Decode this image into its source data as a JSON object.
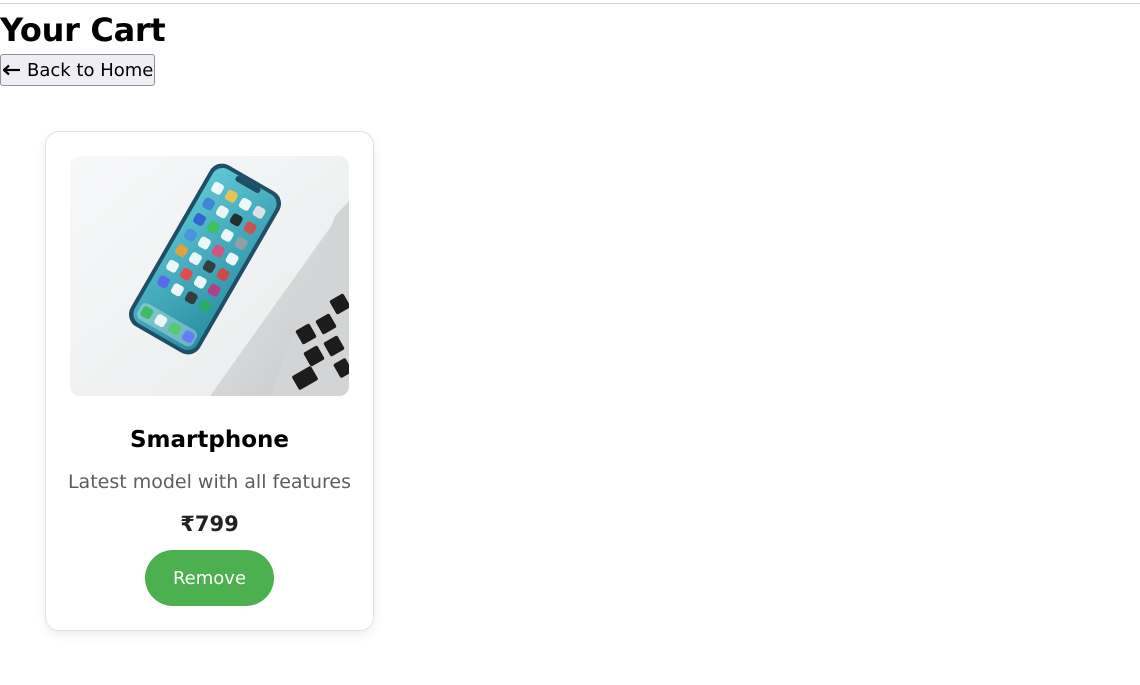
{
  "page": {
    "title": "Your Cart",
    "back_button": {
      "label": "Back to Home",
      "icon": "arrow-left-icon"
    }
  },
  "cart": {
    "items": [
      {
        "name": "Smartphone",
        "description": "Latest model with all features",
        "price": "₹799",
        "image_icon": "smartphone-photo",
        "remove_label": "Remove"
      }
    ]
  },
  "colors": {
    "remove_button": "#4caf50",
    "description_text": "#5d5d5d",
    "card_border": "#e2e2e2"
  }
}
